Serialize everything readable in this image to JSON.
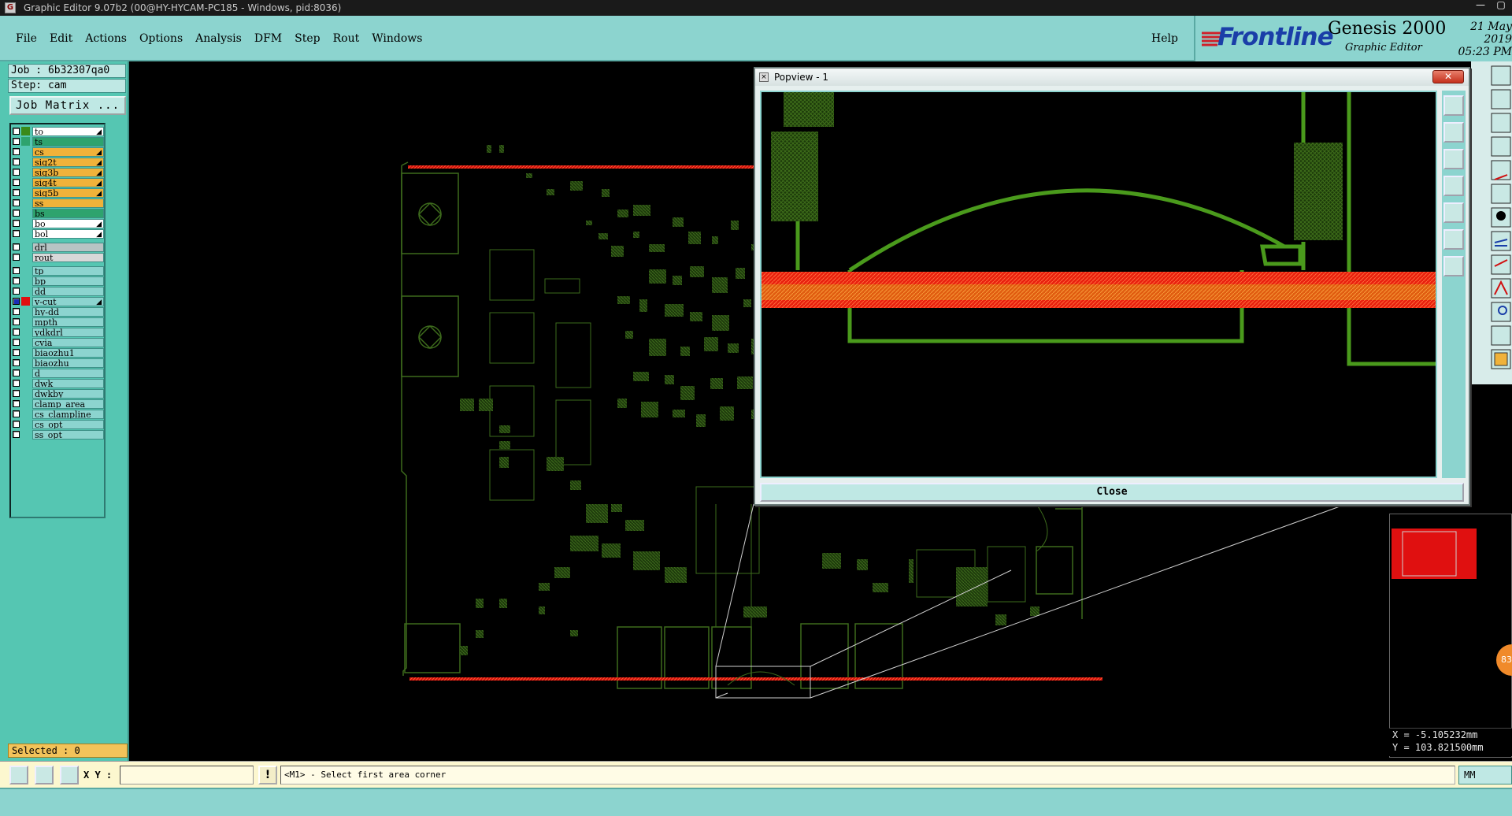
{
  "window": {
    "title": "Graphic Editor 9.07b2 (00@HY-HYCAM-PC185 - Windows, pid:8036)"
  },
  "menu": [
    "File",
    "Edit",
    "Actions",
    "Options",
    "Analysis",
    "DFM",
    "Step",
    "Rout",
    "Windows"
  ],
  "help_label": "Help",
  "brand": {
    "logo": "Frontline",
    "product": "Genesis 2000",
    "subtitle": "Graphic Editor",
    "date": "21 May 2019",
    "time": "05:23 PM"
  },
  "job": {
    "job_line": "Job : 6b32307qa0",
    "step_line": "Step: cam",
    "matrix_button": "Job Matrix ..."
  },
  "layers": [
    {
      "name": "to",
      "swatch": "#3a8a1a",
      "bg": "#ffffff",
      "arrow": true
    },
    {
      "name": "ts",
      "swatch": "#2ea36e",
      "bg": "#2ea36e",
      "arrow": false
    },
    {
      "name": "cs",
      "swatch": "",
      "bg": "#f0b23a",
      "arrow": true
    },
    {
      "name": "sig2t",
      "swatch": "",
      "bg": "#f0b23a",
      "arrow": true
    },
    {
      "name": "sig3b",
      "swatch": "",
      "bg": "#f0b23a",
      "arrow": true
    },
    {
      "name": "sig4t",
      "swatch": "",
      "bg": "#f0b23a",
      "arrow": true
    },
    {
      "name": "sig5b",
      "swatch": "",
      "bg": "#f0b23a",
      "arrow": true
    },
    {
      "name": "ss",
      "swatch": "",
      "bg": "#f0b23a",
      "arrow": false
    },
    {
      "name": "bs",
      "swatch": "",
      "bg": "#2ea36e",
      "arrow": false
    },
    {
      "name": "bo",
      "swatch": "",
      "bg": "#ffffff",
      "arrow": true
    },
    {
      "name": "bol",
      "swatch": "",
      "bg": "#ffffff",
      "arrow": true
    },
    {
      "name": "drl",
      "swatch": "",
      "bg": "#b8c4c4",
      "arrow": false,
      "gap": true
    },
    {
      "name": "rout",
      "swatch": "",
      "bg": "#d8d8d8",
      "arrow": false
    },
    {
      "name": "tp",
      "swatch": "",
      "bg": "#8cd4cf",
      "arrow": false,
      "gap": true
    },
    {
      "name": "bp",
      "swatch": "",
      "bg": "#8cd4cf",
      "arrow": false
    },
    {
      "name": "dd",
      "swatch": "",
      "bg": "#8cd4cf",
      "arrow": false
    },
    {
      "name": "v-cut",
      "swatch": "#e01010",
      "bg": "#8cd4cf",
      "arrow": true,
      "blue": true
    },
    {
      "name": "hy-dd",
      "swatch": "",
      "bg": "#8cd4cf",
      "arrow": false
    },
    {
      "name": "mpth",
      "swatch": "",
      "bg": "#8cd4cf",
      "arrow": false
    },
    {
      "name": "ydkdrl",
      "swatch": "",
      "bg": "#8cd4cf",
      "arrow": false
    },
    {
      "name": "cvia",
      "swatch": "",
      "bg": "#8cd4cf",
      "arrow": false
    },
    {
      "name": "biaozhu1",
      "swatch": "",
      "bg": "#8cd4cf",
      "arrow": false
    },
    {
      "name": "biaozhu",
      "swatch": "",
      "bg": "#8cd4cf",
      "arrow": false
    },
    {
      "name": "d",
      "swatch": "",
      "bg": "#8cd4cf",
      "arrow": false
    },
    {
      "name": "dwk",
      "swatch": "",
      "bg": "#8cd4cf",
      "arrow": false
    },
    {
      "name": "dwkby",
      "swatch": "",
      "bg": "#8cd4cf",
      "arrow": false
    },
    {
      "name": "clamp_area",
      "swatch": "",
      "bg": "#8cd4cf",
      "arrow": false
    },
    {
      "name": "cs_clampline",
      "swatch": "",
      "bg": "#8cd4cf",
      "arrow": false
    },
    {
      "name": "cs_opt",
      "swatch": "",
      "bg": "#8cd4cf",
      "arrow": false
    },
    {
      "name": "ss_opt",
      "swatch": "",
      "bg": "#8cd4cf",
      "arrow": false
    }
  ],
  "selected": "Selected : 0",
  "command": {
    "xy_label": "X Y :",
    "xy_value": "",
    "prompt": "<M1> - Select first area corner",
    "units": "MM"
  },
  "popview": {
    "title": "Popview - 1",
    "close_x": "✕",
    "close_button": "Close"
  },
  "coords": {
    "x": "X = -5.105232mm",
    "y": "Y = 103.821500mm"
  },
  "badge": "83",
  "colors": {
    "teal": "#8cd4cf",
    "panel": "#55c6b2",
    "trace_green": "#4a8a1a",
    "vcut_red": "#e01010"
  }
}
